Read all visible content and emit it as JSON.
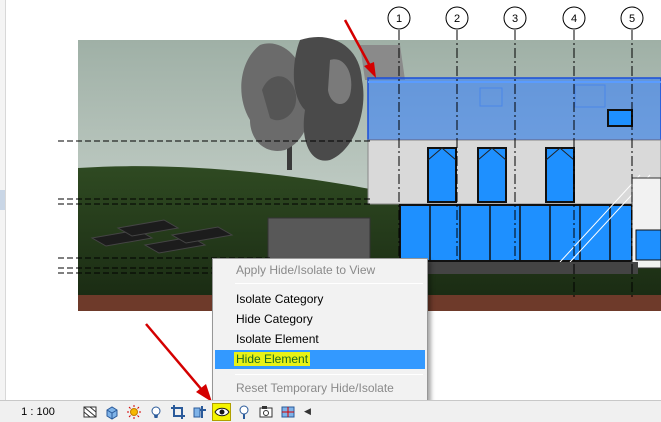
{
  "view": {
    "grid_labels": [
      "1",
      "2",
      "3",
      "4",
      "5"
    ]
  },
  "status_bar": {
    "scale": "1 : 100",
    "icons": [
      "detail-level-icon",
      "visual-style-icon",
      "sun-path-icon",
      "shadows-icon",
      "crop-view-icon",
      "show-crop-region-icon",
      "temporary-hide-isolate-icon",
      "reveal-hidden-elements-icon",
      "temporary-view-properties-icon",
      "analytical-model-icon",
      "scroll-left-icon"
    ]
  },
  "context_menu": {
    "apply_to_view": "Apply Hide/Isolate to View",
    "isolate_category": "Isolate Category",
    "hide_category": "Hide Category",
    "isolate_element": "Isolate Element",
    "hide_element": "Hide Element",
    "reset": "Reset Temporary Hide/Isolate"
  },
  "colors": {
    "selection_blue": "#3399ff",
    "highlight_yellow": "#f5f500",
    "annotation_red": "#d40000",
    "glass_blue": "#1e90ff"
  }
}
